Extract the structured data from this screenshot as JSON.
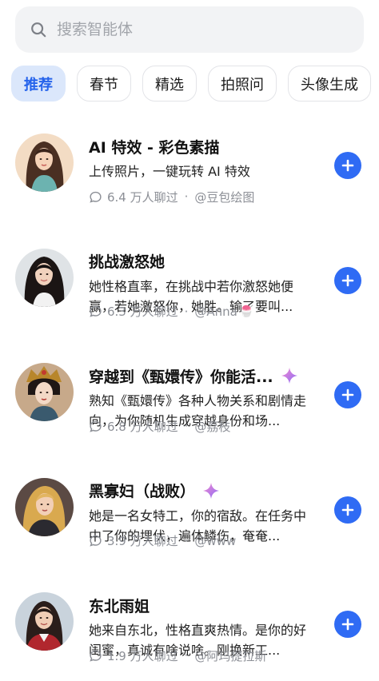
{
  "search": {
    "placeholder": "搜索智能体"
  },
  "tabs": [
    {
      "label": "推荐",
      "active": true
    },
    {
      "label": "春节"
    },
    {
      "label": "精选"
    },
    {
      "label": "拍照问"
    },
    {
      "label": "头像生成"
    }
  ],
  "agents": [
    {
      "title": "AI 特效 - 彩色素描",
      "desc": "上传照片，一键玩转 AI 特效",
      "chats": "6.4 万人聊过",
      "author": "@豆包绘图",
      "featured": false,
      "avatar_icon": "woman-sketch-avatar"
    },
    {
      "title": "挑战激怒她",
      "desc": "她性格直率，在挑战中若你激怒她便赢，若她激怒你，她胜。输了要叫...",
      "chats": "6.3 万人聊过",
      "author": "@Anna",
      "author_badge": "🍧",
      "featured": false,
      "avatar_icon": "woman-portrait-avatar"
    },
    {
      "title": "穿越到《甄嬛传》你能活...",
      "desc": "熟知《甄嬛传》各种人物关系和剧情走向，为你随机生成穿越身份和场...",
      "chats": "6.8 万人聊过",
      "author": "@荔枝",
      "featured": true,
      "avatar_icon": "empress-avatar"
    },
    {
      "title": "黑寡妇（战败）",
      "desc": "她是一名女特工，你的宿敌。在任务中中了你的埋伏，遍体鳞伤，奄奄...",
      "chats": "3.9 万人聊过",
      "author": "@www",
      "featured": true,
      "avatar_icon": "agent-woman-avatar"
    },
    {
      "title": "东北雨姐",
      "desc": "她来自东北，性格直爽热情。是你的好闺蜜，真诚有啥说啥。刚换新工...",
      "chats": "1.9 万人聊过",
      "author": "@阿玛提拉斯",
      "featured": false,
      "avatar_icon": "office-woman-avatar"
    }
  ],
  "colors": {
    "accent": "#2f6bf4",
    "tab_active_bg": "#dbe7fb",
    "tab_active_text": "#2563eb",
    "meta_text": "#8c8f96"
  }
}
